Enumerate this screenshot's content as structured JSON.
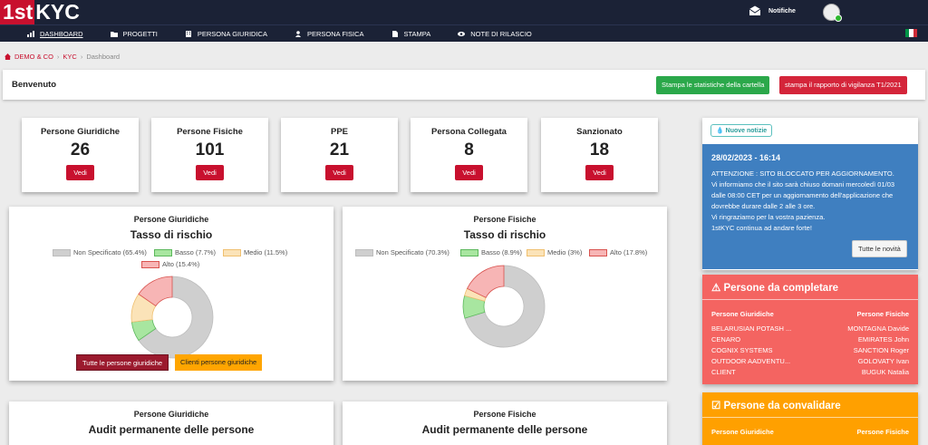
{
  "logo": {
    "part1": "1st",
    "part2": "KYC"
  },
  "header": {
    "notifications_label": "Notifiche"
  },
  "nav": [
    {
      "label": "DASHBOARD",
      "icon": "chart-icon"
    },
    {
      "label": "PROGETTI",
      "icon": "folder-icon"
    },
    {
      "label": "PERSONA GIURIDICA",
      "icon": "building-icon"
    },
    {
      "label": "PERSONA FISICA",
      "icon": "user-icon"
    },
    {
      "label": "STAMPA",
      "icon": "file-icon"
    },
    {
      "label": "NOTE DI RILASCIO",
      "icon": "eye-icon"
    }
  ],
  "breadcrumb": [
    "DEMO & CO",
    "KYC",
    "Dashboard"
  ],
  "welcome": {
    "title": "Benvenuto",
    "btn_stats": "Stampa le statistiche della cartella",
    "btn_report": "stampa il rapporto di vigilanza T1/2021"
  },
  "stats": [
    {
      "title": "Persone Giuridiche",
      "value": "26",
      "button": "Vedi"
    },
    {
      "title": "Persone Fisiche",
      "value": "101",
      "button": "Vedi"
    },
    {
      "title": "PPE",
      "value": "21",
      "button": "Vedi"
    },
    {
      "title": "Persona Collegata",
      "value": "8",
      "button": "Vedi"
    },
    {
      "title": "Sanzionato",
      "value": "18",
      "button": "Vedi"
    }
  ],
  "risk_left": {
    "header": "Persone Giuridiche",
    "title": "Tasso di rischio",
    "btn_all": "Tutte le persone giuridiche",
    "btn_clients": "Clienti persone giuridiche"
  },
  "risk_right": {
    "header": "Persone Fisiche",
    "title": "Tasso di rischio"
  },
  "audit_left": {
    "header": "Persone Giuridiche",
    "title": "Audit permanente delle persone"
  },
  "audit_right": {
    "header": "Persone Fisiche",
    "title": "Audit permanente delle persone"
  },
  "chart_data": [
    {
      "type": "pie",
      "title": "Tasso di rischio",
      "series": [
        {
          "name": "Non Specificato",
          "label": "Non Specificato (65.4%)",
          "value": 65.4,
          "fill": "#cfcfcf",
          "stroke": "#bdbdbd"
        },
        {
          "name": "Basso",
          "label": "Basso (7.7%)",
          "value": 7.7,
          "fill": "#a8e6a0",
          "stroke": "#5cb85c"
        },
        {
          "name": "Medio",
          "label": "Medio (11.5%)",
          "value": 11.5,
          "fill": "#fbe3b8",
          "stroke": "#f0c070"
        },
        {
          "name": "Alto",
          "label": "Alto (15.4%)",
          "value": 15.4,
          "fill": "#f7b5b5",
          "stroke": "#d9534f"
        }
      ]
    },
    {
      "type": "pie",
      "title": "Tasso di rischio",
      "series": [
        {
          "name": "Non Specificato",
          "label": "Non Specificato (70.3%)",
          "value": 70.3,
          "fill": "#cfcfcf",
          "stroke": "#bdbdbd"
        },
        {
          "name": "Basso",
          "label": "Basso (8.9%)",
          "value": 8.9,
          "fill": "#a8e6a0",
          "stroke": "#5cb85c"
        },
        {
          "name": "Medio",
          "label": "Medio (3%)",
          "value": 3,
          "fill": "#fbe3b8",
          "stroke": "#f0c070"
        },
        {
          "name": "Alto",
          "label": "Alto (17.8%)",
          "value": 17.8,
          "fill": "#f7b5b5",
          "stroke": "#d9534f"
        }
      ]
    }
  ],
  "news": {
    "badge": "Nuove notizie",
    "date": "28/02/2023 - 16:14",
    "lines": [
      "ATTENZIONE : SITO BLOCCATO PER AGGIORNAMENTO.",
      "Vi informiamo che il sito sarà chiuso domani mercoledì 01/03",
      "dalle 08:00 CET per un aggiornamento dell'applicazione che",
      "dovrebbe durare dalle 2 alle 3 ore.",
      "Vi ringraziamo per la vostra pazienza.",
      "1stKYC continua ad andare forte!"
    ],
    "button": "Tutte le novità"
  },
  "todo": {
    "title": "Persone da completare",
    "col_left": "Persone Giuridiche",
    "col_right": "Persone Fisiche",
    "left": [
      "BELARUSIAN POTASH ...",
      "CENARO",
      "COGNIX SYSTEMS",
      "OUTDOOR AADVENTU...",
      "CLIENT"
    ],
    "right": [
      "MONTAGNA Davide",
      "EMIRATES John",
      "SANCTION Roger",
      "GOLOVATY Ivan",
      "BUGUK Natalia"
    ]
  },
  "validate": {
    "title": "Persone da convalidare",
    "col_left": "Persone Giuridiche",
    "col_right": "Persone Fisiche"
  },
  "colors": {
    "brand_red": "#c8102e",
    "navbar": "#1b2236",
    "news_blue": "#3f7fc0",
    "todo_red": "#f46461",
    "validate_orange": "#ffa000"
  }
}
